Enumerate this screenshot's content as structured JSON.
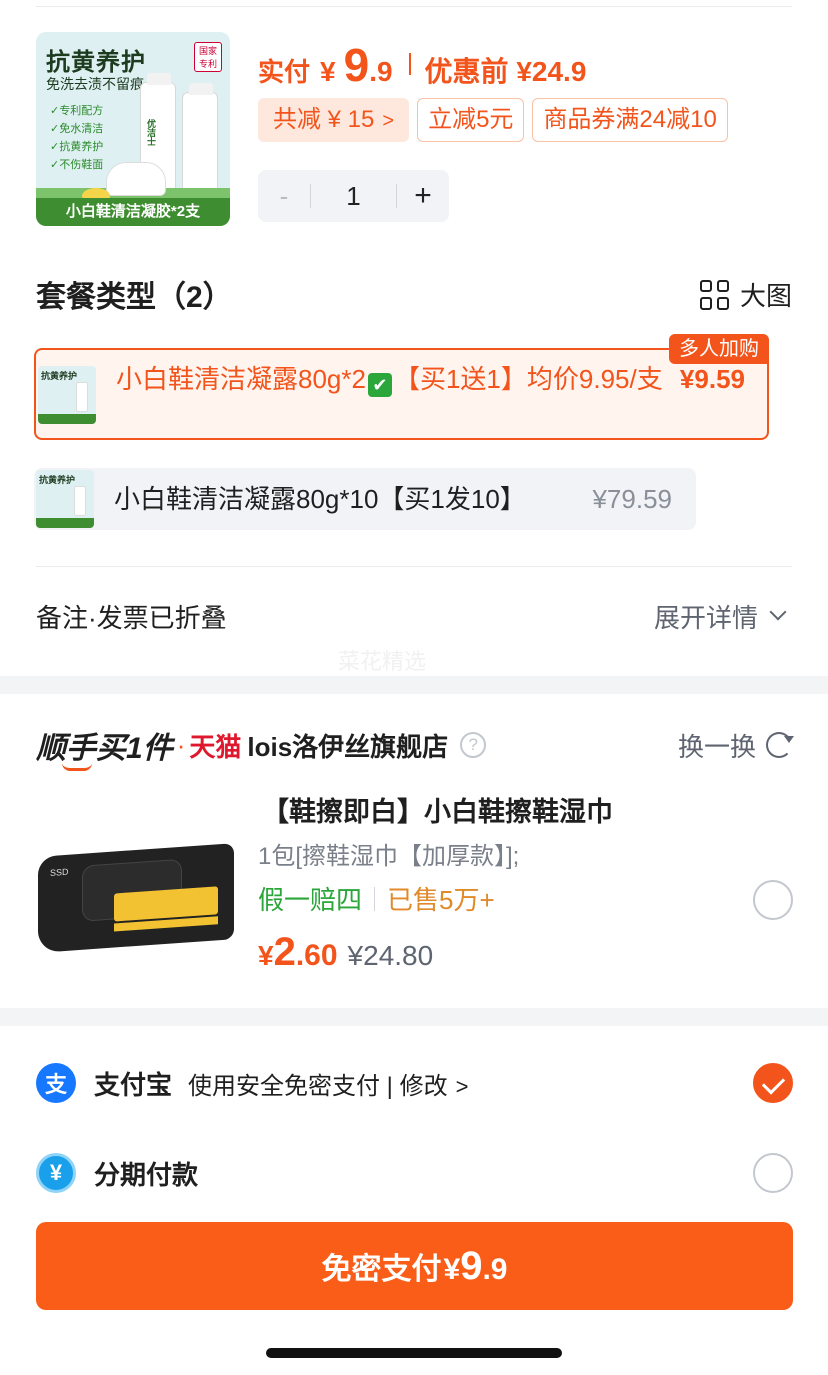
{
  "product": {
    "image": {
      "title": "抗黄养护",
      "subtitle": "免洗去渍不留痕",
      "features": [
        "✓专利配方",
        "✓免水清洁",
        "✓抗黄养护",
        "✓不伤鞋面"
      ],
      "brand": "优洁士",
      "band": "小白鞋清洁凝胶*2支",
      "badge": "国家专利"
    },
    "pay_label": "实付",
    "currency": "¥",
    "price_int": "9",
    "price_dec": ".9",
    "orig_label": "优惠前 ¥24.9",
    "tags": [
      {
        "label": "共减 ¥ 15",
        "chevron": ">"
      },
      {
        "label": "立减5元"
      },
      {
        "label": "商品券满24减10"
      }
    ],
    "quantity": "1",
    "minus": "-",
    "plus": "+"
  },
  "package": {
    "title": "套餐类型（2）",
    "big_image_label": "大图",
    "options": [
      {
        "text_before": "小白鞋清洁凝露80g*2",
        "emoji": "✔",
        "text_after": "【买1送1】均价9.95/支",
        "price": "¥9.59",
        "badge": "多人加购",
        "selected": true
      },
      {
        "text": "小白鞋清洁凝露80g*10【买1发10】",
        "price": "¥79.59",
        "selected": false
      }
    ]
  },
  "remark": {
    "label": "备注·发票已折叠",
    "expand_label": "展开详情"
  },
  "watermark": "菜花精选",
  "convenience": {
    "logo": "顺手买1件",
    "dot": "·",
    "tmall": "天猫",
    "store": "lois洛伊丝旗舰店",
    "help": "?",
    "swap_label": "换一换",
    "item": {
      "name": "【鞋擦即白】小白鞋擦鞋湿巾",
      "spec": "1包[擦鞋湿巾【加厚款】];",
      "guarantee": "假一赔四",
      "sold": "已售5万+",
      "currency": "¥",
      "price_int": "2",
      "price_dec": ".60",
      "orig_price": "¥24.80",
      "pack_brand": "SSD"
    }
  },
  "payment": {
    "methods": [
      {
        "icon": "支",
        "name": "支付宝",
        "desc": "使用安全免密支付 | 修改",
        "chevron": ">",
        "selected": true
      },
      {
        "icon": "¥",
        "name": "分期付款",
        "desc": "",
        "selected": false
      }
    ],
    "button": {
      "label": "免密支付",
      "currency": "¥",
      "price_int": "9",
      "price_dec": ".9"
    }
  },
  "colors": {
    "accent": "#f2541b",
    "button": "#f95d17",
    "green": "#2aa63a",
    "alipay": "#1677ff"
  }
}
